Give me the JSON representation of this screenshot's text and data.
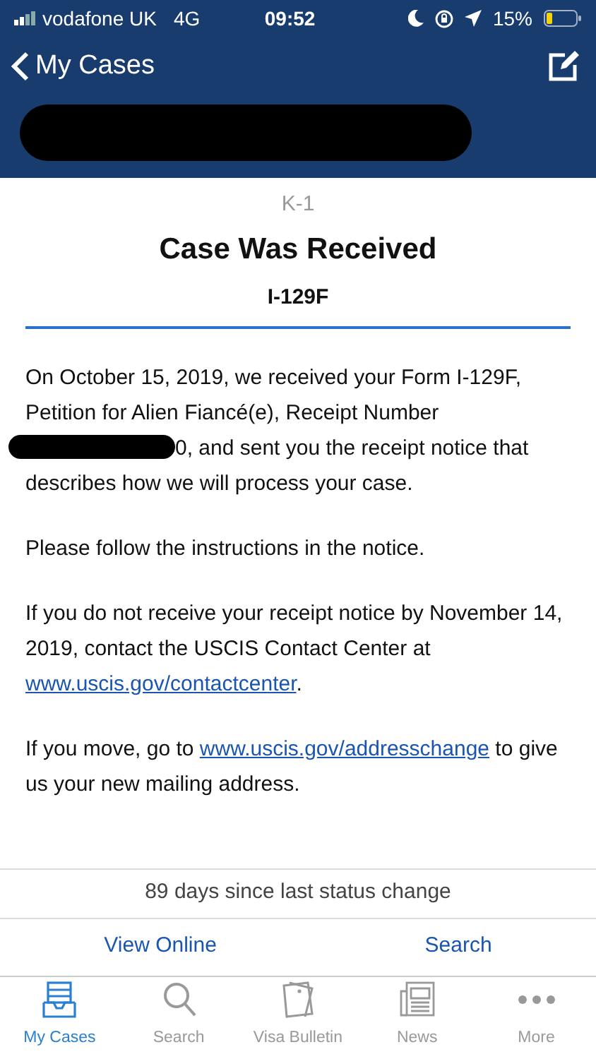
{
  "status_bar": {
    "carrier": "vodafone UK",
    "network": "4G",
    "time": "09:52",
    "battery": "15%"
  },
  "nav": {
    "back_label": "My Cases",
    "header_redacted": true
  },
  "case": {
    "category": "K-1",
    "title": "Case Was Received",
    "form": "I-129F"
  },
  "paragraphs": [
    [
      {
        "kind": "text",
        "text": "On October 15, 2019, we received your Form I-129F, Petition for Alien Fiancé(e), Receipt Number "
      },
      {
        "kind": "redacted"
      },
      {
        "kind": "text",
        "text": "0, and sent you the receipt notice that describes how we will process your case."
      }
    ],
    [
      {
        "kind": "text",
        "text": "Please follow the instructions in the notice."
      }
    ],
    [
      {
        "kind": "text",
        "text": "If you do not receive your receipt notice by November 14, 2019, contact the USCIS Contact Center at "
      },
      {
        "kind": "link",
        "text": "www.uscis.gov/contactcenter"
      },
      {
        "kind": "text",
        "text": "."
      }
    ],
    [
      {
        "kind": "text",
        "text": "If you move, go to "
      },
      {
        "kind": "link",
        "text": "www.uscis.gov/addresschange"
      },
      {
        "kind": "text",
        "text": " to give us your new mailing address."
      }
    ]
  ],
  "status_change": "89 days since last status change",
  "actions": [
    "View Online",
    "Search"
  ],
  "tabs": [
    {
      "label": "My Cases",
      "selected": true
    },
    {
      "label": "Search",
      "selected": false
    },
    {
      "label": "Visa Bulletin",
      "selected": false
    },
    {
      "label": "News",
      "selected": false
    },
    {
      "label": "More",
      "selected": false
    }
  ]
}
